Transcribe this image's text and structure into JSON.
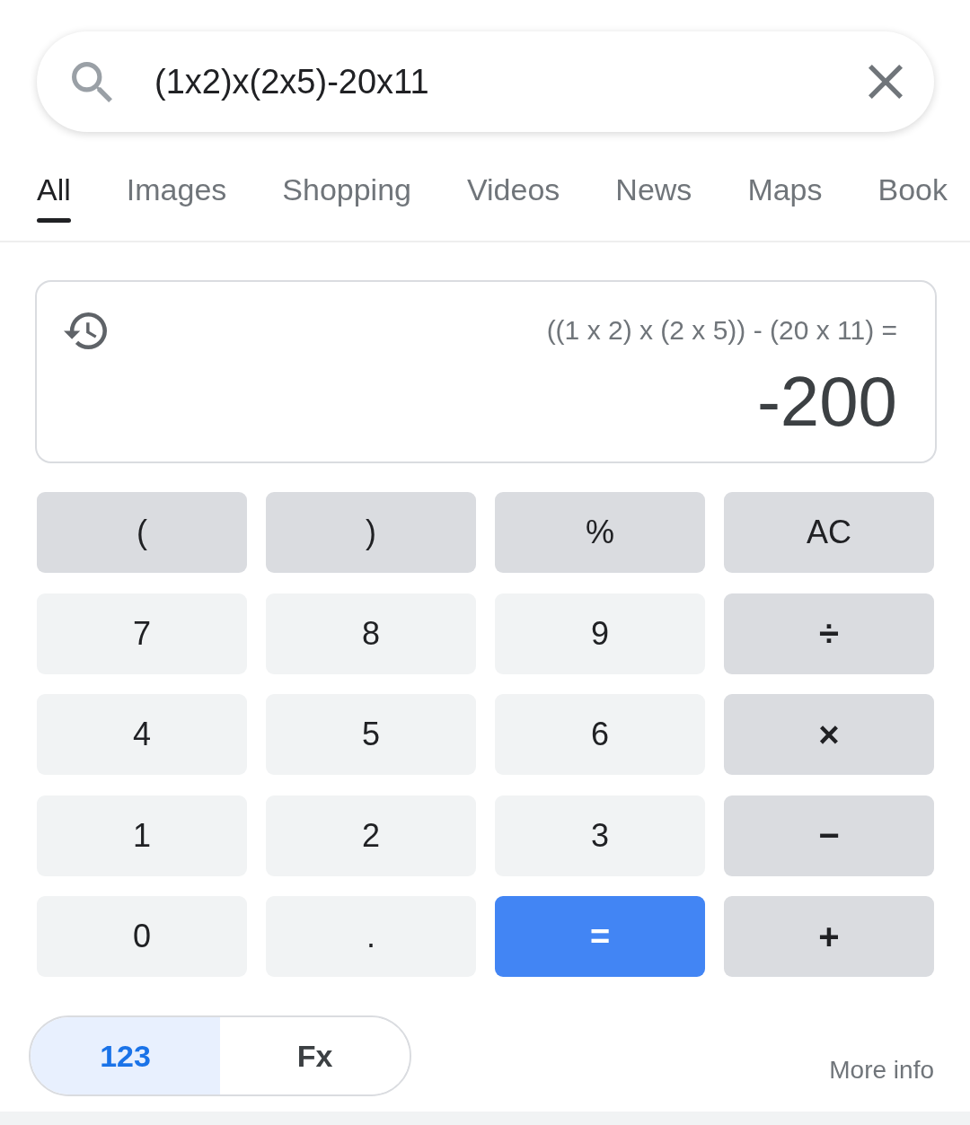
{
  "search": {
    "query": "(1x2)x(2x5)-20x11"
  },
  "tabs": [
    {
      "label": "All",
      "selected": true
    },
    {
      "label": "Images",
      "selected": false
    },
    {
      "label": "Shopping",
      "selected": false
    },
    {
      "label": "Videos",
      "selected": false
    },
    {
      "label": "News",
      "selected": false
    },
    {
      "label": "Maps",
      "selected": false
    },
    {
      "label": "Book",
      "selected": false
    }
  ],
  "calculator": {
    "expression": "((1 x 2) x (2 x 5)) - (20 x 11) =",
    "result": "-200",
    "keys": [
      {
        "label": "(",
        "kind": "function"
      },
      {
        "label": ")",
        "kind": "function"
      },
      {
        "label": "%",
        "kind": "function"
      },
      {
        "label": "AC",
        "kind": "function"
      },
      {
        "label": "7",
        "kind": "digit"
      },
      {
        "label": "8",
        "kind": "digit"
      },
      {
        "label": "9",
        "kind": "digit"
      },
      {
        "label": "÷",
        "kind": "operator"
      },
      {
        "label": "4",
        "kind": "digit"
      },
      {
        "label": "5",
        "kind": "digit"
      },
      {
        "label": "6",
        "kind": "digit"
      },
      {
        "label": "×",
        "kind": "operator"
      },
      {
        "label": "1",
        "kind": "digit"
      },
      {
        "label": "2",
        "kind": "digit"
      },
      {
        "label": "3",
        "kind": "digit"
      },
      {
        "label": "−",
        "kind": "operator"
      },
      {
        "label": "0",
        "kind": "digit"
      },
      {
        "label": ".",
        "kind": "digit"
      },
      {
        "label": "=",
        "kind": "equals"
      },
      {
        "label": "+",
        "kind": "operator"
      }
    ],
    "modes": [
      {
        "label": "123",
        "selected": true
      },
      {
        "label": "Fx",
        "selected": false
      }
    ],
    "more_info": "More info"
  }
}
